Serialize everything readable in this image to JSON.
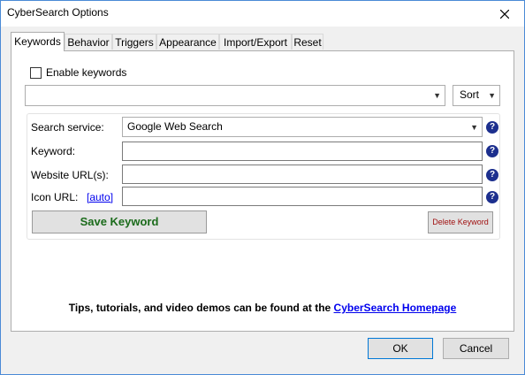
{
  "window": {
    "title": "CyberSearch Options"
  },
  "tabs": [
    {
      "label": "Keywords",
      "active": true
    },
    {
      "label": "Behavior"
    },
    {
      "label": "Triggers"
    },
    {
      "label": "Appearance"
    },
    {
      "label": "Import/Export"
    },
    {
      "label": "Reset"
    }
  ],
  "keywords": {
    "enable_label": "Enable keywords",
    "enable_checked": false,
    "keyword_select_value": "",
    "sort_label": "Sort",
    "search_service_label": "Search service:",
    "search_service_value": "Google Web Search",
    "keyword_label": "Keyword:",
    "keyword_value": "",
    "website_label": "Website URL(s):",
    "website_value": "",
    "icon_label": "Icon URL:",
    "icon_auto_link": "[auto]",
    "icon_value": "",
    "save_label": "Save Keyword",
    "delete_label": "Delete Keyword",
    "tips_text": "Tips, tutorials, and video demos can be found at the",
    "tips_link": "CyberSearch Homepage",
    "help_glyph": "?"
  },
  "footer": {
    "ok_label": "OK",
    "cancel_label": "Cancel"
  },
  "colors": {
    "save_text": "#1b6b1b",
    "delete_text": "#a01010",
    "help_icon_bg": "#1c2f8e",
    "link": "#0000ee"
  },
  "icons": [
    "close-icon",
    "chevron-down-icon",
    "help-icon"
  ]
}
